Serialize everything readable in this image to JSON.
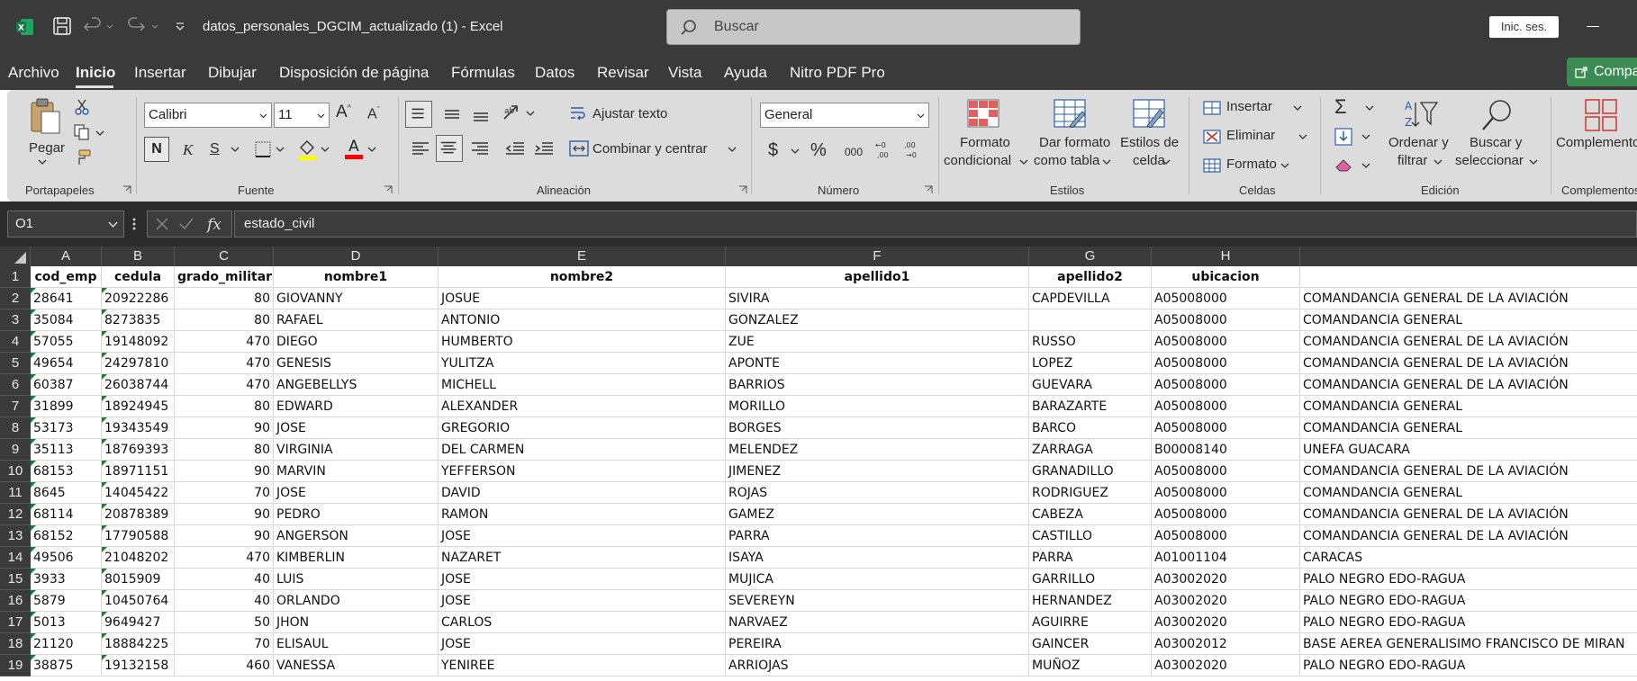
{
  "titlebar": {
    "doc_title": "datos_personales_DGCIM_actualizado (1)  -  Excel",
    "search_placeholder": "Buscar",
    "signin_label": "Inic. ses."
  },
  "menu": {
    "tabs": [
      "Archivo",
      "Inicio",
      "Insertar",
      "Dibujar",
      "Disposición de página",
      "Fórmulas",
      "Datos",
      "Revisar",
      "Vista",
      "Ayuda",
      "Nitro PDF Pro"
    ],
    "active": "Inicio",
    "share_label": "Compa"
  },
  "ribbon": {
    "clipboard": {
      "paste_label": "Pegar",
      "group_label": "Portapapeles"
    },
    "font": {
      "font_name": "Calibri",
      "font_size": "11",
      "bold": "N",
      "italic": "K",
      "underline": "S",
      "group_label": "Fuente",
      "highlight_color": "#ffff00",
      "font_color": "#ff0000"
    },
    "alignment": {
      "wrap_label": "Ajustar texto",
      "merge_label": "Combinar y centrar",
      "group_label": "Alineación"
    },
    "number": {
      "format": "General",
      "currency": "$",
      "percent": "%",
      "thousands": "000",
      "group_label": "Número"
    },
    "styles": {
      "conditional_l1": "Formato",
      "conditional_l2": "condicional",
      "table_l1": "Dar formato",
      "table_l2": "como tabla",
      "cell_l1": "Estilos de",
      "cell_l2": "celda",
      "group_label": "Estilos"
    },
    "cells": {
      "insert": "Insertar",
      "delete": "Eliminar",
      "format": "Formato",
      "group_label": "Celdas"
    },
    "editing": {
      "sort_l1": "Ordenar y",
      "sort_l2": "filtrar",
      "find_l1": "Buscar y",
      "find_l2": "seleccionar",
      "group_label": "Edición"
    },
    "addins": {
      "label": "Complementos",
      "group_label": "Complementos"
    }
  },
  "formula_bar": {
    "name_box": "O1",
    "formula": "estado_civil"
  },
  "sheet": {
    "columns": [
      "A",
      "B",
      "C",
      "D",
      "E",
      "F",
      "G",
      "H"
    ],
    "headers": [
      "cod_emp",
      "cedula",
      "grado_militar",
      "nombre1",
      "nombre2",
      "apellido1",
      "apellido2",
      "ubicacion"
    ],
    "rows": [
      [
        "28641",
        "20922286",
        "80",
        "GIOVANNY",
        "JOSUE",
        "SIVIRA",
        "CAPDEVILLA",
        "A05008000",
        "COMANDANCIA GENERAL DE LA AVIACIÓN"
      ],
      [
        "35084",
        "8273835",
        "80",
        "RAFAEL",
        "ANTONIO",
        "GONZALEZ",
        "",
        "A05008000",
        "COMANDANCIA GENERAL"
      ],
      [
        "57055",
        "19148092",
        "470",
        "DIEGO",
        "HUMBERTO",
        "ZUE",
        "RUSSO",
        "A05008000",
        "COMANDANCIA GENERAL DE LA AVIACIÓN"
      ],
      [
        "49654",
        "24297810",
        "470",
        "GENESIS",
        "YULITZA",
        "APONTE",
        "LOPEZ",
        "A05008000",
        "COMANDANCIA GENERAL DE LA AVIACIÓN"
      ],
      [
        "60387",
        "26038744",
        "470",
        "ANGEBELLYS",
        "MICHELL",
        "BARRIOS",
        "GUEVARA",
        "A05008000",
        "COMANDANCIA GENERAL DE LA AVIACIÓN"
      ],
      [
        "31899",
        "18924945",
        "80",
        "EDWARD",
        "ALEXANDER",
        "MORILLO",
        "BARAZARTE",
        "A05008000",
        "COMANDANCIA GENERAL"
      ],
      [
        "53173",
        "19343549",
        "90",
        "JOSE",
        "GREGORIO",
        "BORGES",
        "BARCO",
        "A05008000",
        "COMANDANCIA GENERAL"
      ],
      [
        "35113",
        "18769393",
        "80",
        "VIRGINIA",
        "DEL CARMEN",
        "MELENDEZ",
        "ZARRAGA",
        "B00008140",
        "UNEFA GUACARA"
      ],
      [
        "68153",
        "18971151",
        "90",
        "MARVIN",
        "YEFFERSON",
        "JIMENEZ",
        "GRANADILLO",
        "A05008000",
        "COMANDANCIA GENERAL DE LA AVIACIÓN"
      ],
      [
        "8645",
        "14045422",
        "70",
        "JOSE",
        "DAVID",
        "ROJAS",
        "RODRIGUEZ",
        "A05008000",
        "COMANDANCIA GENERAL"
      ],
      [
        "68114",
        "20878389",
        "90",
        "PEDRO",
        "RAMON",
        "GAMEZ",
        "CABEZA",
        "A05008000",
        "COMANDANCIA GENERAL DE LA AVIACIÓN"
      ],
      [
        "68152",
        "17790588",
        "90",
        " ANGERSON",
        "JOSE",
        "PARRA",
        "CASTILLO",
        "A05008000",
        "COMANDANCIA GENERAL DE LA AVIACIÓN"
      ],
      [
        "49506",
        "21048202",
        "470",
        "KIMBERLIN",
        "NAZARET",
        "ISAYA",
        "PARRA",
        "A01001104",
        "CARACAS"
      ],
      [
        "3933",
        "8015909",
        "40",
        "LUIS",
        "JOSE",
        "MUJICA",
        "GARRILLO",
        "A03002020",
        "PALO NEGRO EDO-RAGUA"
      ],
      [
        "5879",
        "10450764",
        "40",
        "ORLANDO",
        "JOSE",
        "SEVEREYN",
        "HERNANDEZ",
        "A03002020",
        "PALO NEGRO EDO-RAGUA"
      ],
      [
        "5013",
        "9649427",
        "50",
        "JHON",
        "CARLOS",
        "NARVAEZ",
        "AGUIRRE",
        "A03002020",
        "PALO NEGRO EDO-RAGUA"
      ],
      [
        "21120",
        "18884225",
        "70",
        "ELISAUL",
        "JOSE",
        "PEREIRA",
        "GAINCER",
        "A03002012",
        "BASE AEREA GENERALISIMO FRANCISCO DE MIRAN"
      ],
      [
        "38875",
        "19132158",
        "460",
        "VANESSA",
        "YENIREE",
        "ARRIOJAS",
        "MUÑOZ",
        "A03002020",
        "PALO NEGRO EDO-RAGUA"
      ]
    ]
  }
}
